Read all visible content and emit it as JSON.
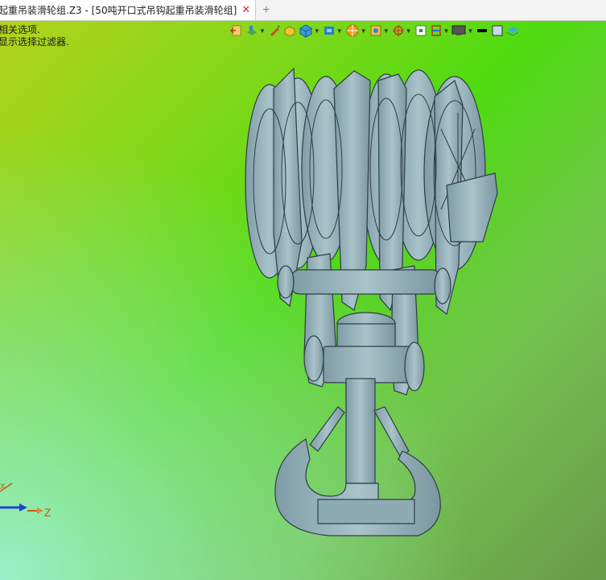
{
  "tab": {
    "title": "起重吊装滑轮组.Z3 - [50吨开口式吊钩起重吊装滑轮组]",
    "close_glyph": "✕",
    "new_tab_glyph": "+"
  },
  "hints": {
    "line1": "相关选项.",
    "line2": "显示选择过滤器."
  },
  "toolbar": {
    "icons": [
      "exit-sketch-icon",
      "layer-icon",
      "pen-icon",
      "shaded-cube-icon",
      "cube-view-icon",
      "view-orient-icon",
      "render-mode-icon",
      "zoom-icon",
      "origin-icon",
      "fit-icon",
      "section-icon",
      "display-icon",
      "line-color",
      "fill-color",
      "layers-stack-icon"
    ]
  },
  "triad": {
    "z_axis_label": "Z",
    "x_axis_label": "X"
  },
  "colors": {
    "model_fill": "#9ab6be",
    "model_stroke": "#2e3e46",
    "axis_z": "#c85a10",
    "axis_blue": "#2244cc"
  }
}
